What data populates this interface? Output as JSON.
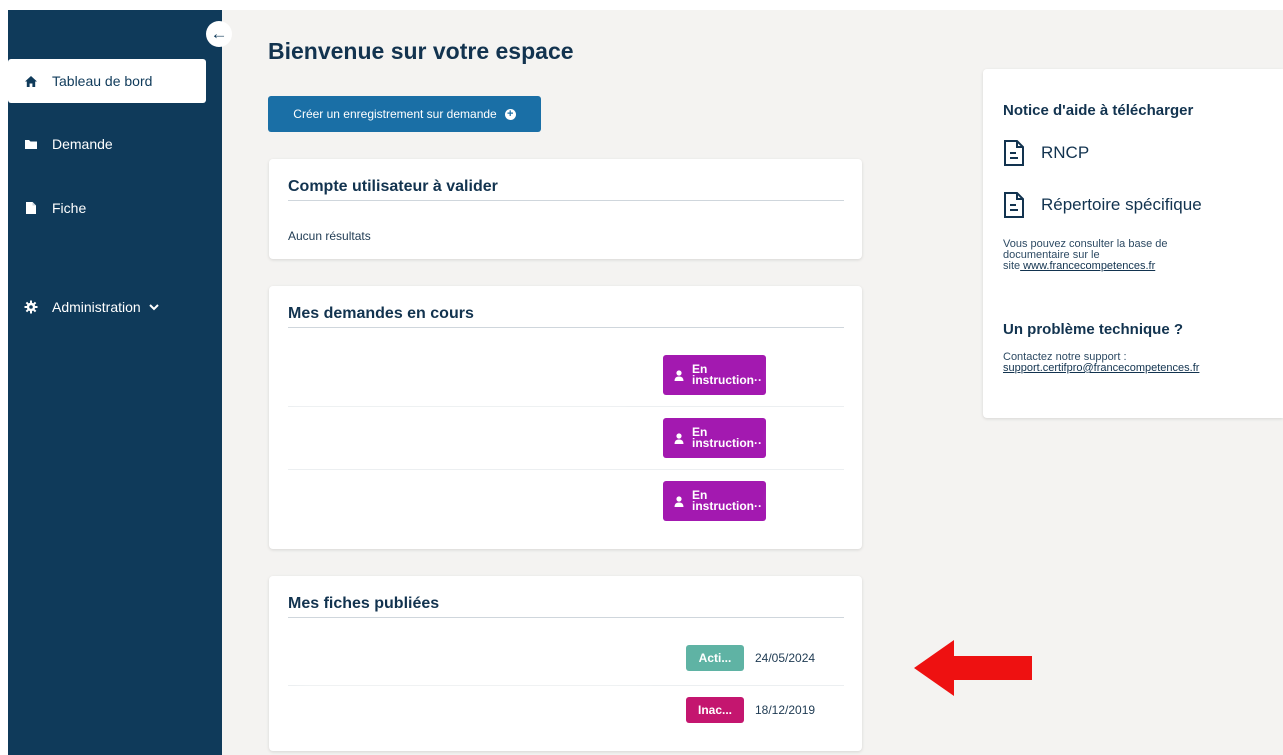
{
  "sidebar": {
    "items": [
      {
        "label": "Tableau de bord",
        "icon": "home-icon",
        "active": true
      },
      {
        "label": "Demande",
        "icon": "folder-icon",
        "active": false
      },
      {
        "label": "Fiche",
        "icon": "file-icon",
        "active": false
      },
      {
        "label": "Administration",
        "icon": "gear-icon",
        "active": false
      }
    ],
    "collapse_icon": "arrow-left-icon"
  },
  "main": {
    "title": "Bienvenue sur votre espace",
    "create_button": "Créer un enregistrement sur demande",
    "accounts_card": {
      "title": "Compte utilisateur à valider",
      "empty_text": "Aucun résultats"
    },
    "requests_card": {
      "title": "Mes demandes en cours",
      "rows": [
        {
          "status": "En\ninstruction··"
        },
        {
          "status": "En\ninstruction··"
        },
        {
          "status": "En\ninstruction··"
        }
      ]
    },
    "published_card": {
      "title": "Mes fiches publiées",
      "rows": [
        {
          "status": "Acti...",
          "date": "24/05/2024",
          "status_color": "#5fb3a4"
        },
        {
          "status": "Inac...",
          "date": "18/12/2019",
          "status_color": "#c4166f"
        }
      ]
    }
  },
  "help": {
    "title": "Notice d'aide à télécharger",
    "docs": [
      {
        "label": "RNCP"
      },
      {
        "label": "Répertoire spécifique"
      }
    ],
    "info_line1": "Vous pouvez consulter la base de",
    "info_line2": "documentaire sur le",
    "info_line3_prefix": "site",
    "info_link": " www.francecompetences.fr",
    "support_title": "Un problème technique ?",
    "support_text": "Contactez notre support :",
    "support_email": "support.certifpro@francecompetences.fr"
  },
  "colors": {
    "sidebar": "#0f3a5a",
    "primary_button": "#1a6fa6",
    "status_instruction": "#a319b0",
    "status_active": "#5fb3a4",
    "status_inactive": "#c4166f",
    "annotation_arrow": "#ee1111"
  }
}
